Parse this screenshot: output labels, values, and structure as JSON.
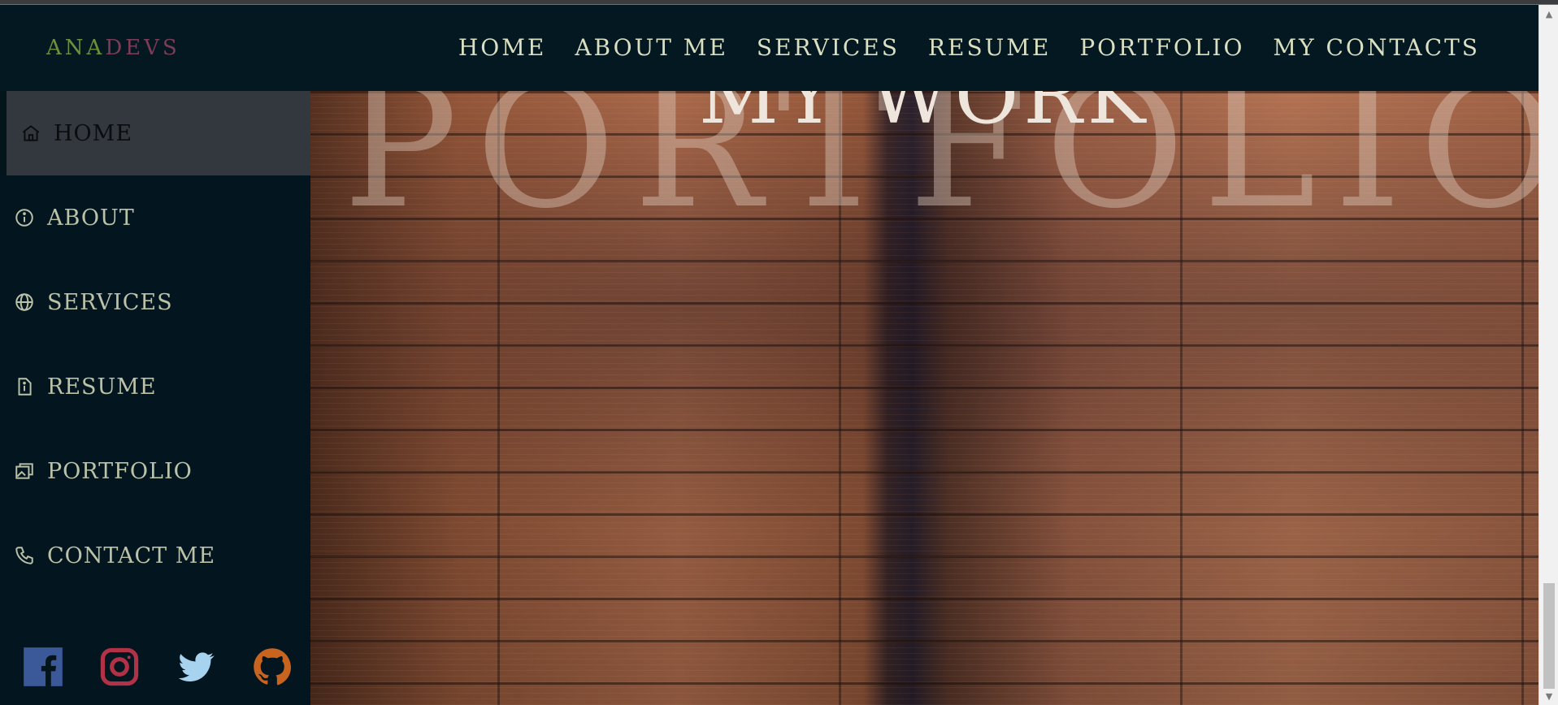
{
  "brand": {
    "part1": "ANA",
    "part2": "DEVS"
  },
  "topnav": {
    "links": [
      {
        "label": "HOME"
      },
      {
        "label": "ABOUT ME"
      },
      {
        "label": "SERVICES"
      },
      {
        "label": "RESUME"
      },
      {
        "label": "PORTFOLIO"
      },
      {
        "label": "MY CONTACTS"
      }
    ]
  },
  "sidebar": {
    "items": [
      {
        "label": "HOME",
        "icon": "home-icon",
        "active": true
      },
      {
        "label": "ABOUT",
        "icon": "info-icon"
      },
      {
        "label": "SERVICES",
        "icon": "globe-icon"
      },
      {
        "label": "RESUME",
        "icon": "document-icon"
      },
      {
        "label": "PORTFOLIO",
        "icon": "images-icon"
      },
      {
        "label": "CONTACT ME",
        "icon": "phone-icon"
      }
    ],
    "socials": [
      {
        "name": "facebook-icon",
        "color": "#3b5998"
      },
      {
        "name": "instagram-icon",
        "color": "#c13584"
      },
      {
        "name": "twitter-icon",
        "color": "#a7d3f0"
      },
      {
        "name": "github-icon",
        "color": "#c8641e"
      }
    ]
  },
  "hero": {
    "background_word": "PORTFOLIO",
    "section_title": "MY WORK"
  },
  "colors": {
    "navbar_bg": "#041822",
    "nav_text": "#d9dfc0",
    "brand_green": "#6f8f3c",
    "brand_maroon": "#7c3c55",
    "sidebar_active_bg": "#33383e"
  }
}
